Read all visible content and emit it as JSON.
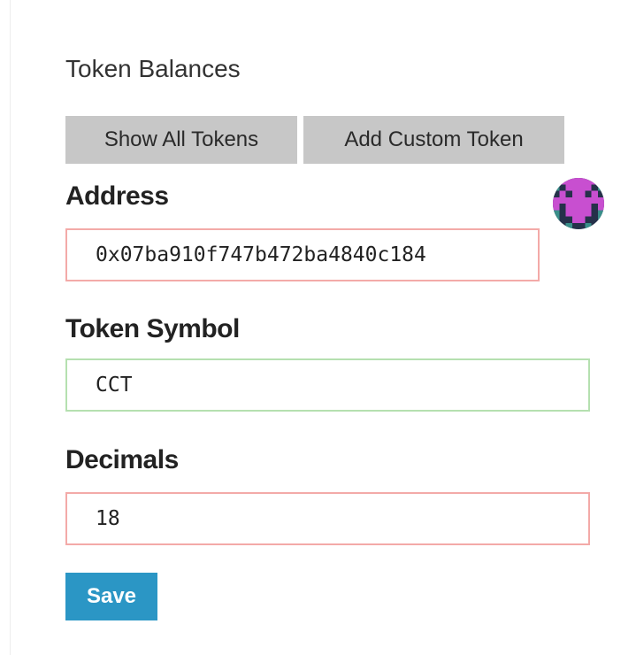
{
  "panel": {
    "title": "Token Balances"
  },
  "buttons": {
    "show_all_tokens": "Show All Tokens",
    "add_custom_token": "Add Custom Token",
    "save": "Save"
  },
  "form": {
    "address": {
      "label": "Address",
      "value": "0x07ba910f747b472ba4840c184",
      "state": "invalid"
    },
    "token_symbol": {
      "label": "Token Symbol",
      "value": "CCT",
      "state": "valid"
    },
    "decimals": {
      "label": "Decimals",
      "value": "18",
      "state": "invalid"
    }
  },
  "icons": {
    "address_identicon": "identicon"
  },
  "colors": {
    "primary_button": "#2b96c5",
    "secondary_button": "#c7c7c7",
    "invalid_border": "#f3aaa8",
    "valid_border": "#b5e0b0",
    "identicon_primary": "#c84fd0",
    "identicon_secondary": "#25314a",
    "identicon_accent": "#3a8f8a"
  }
}
